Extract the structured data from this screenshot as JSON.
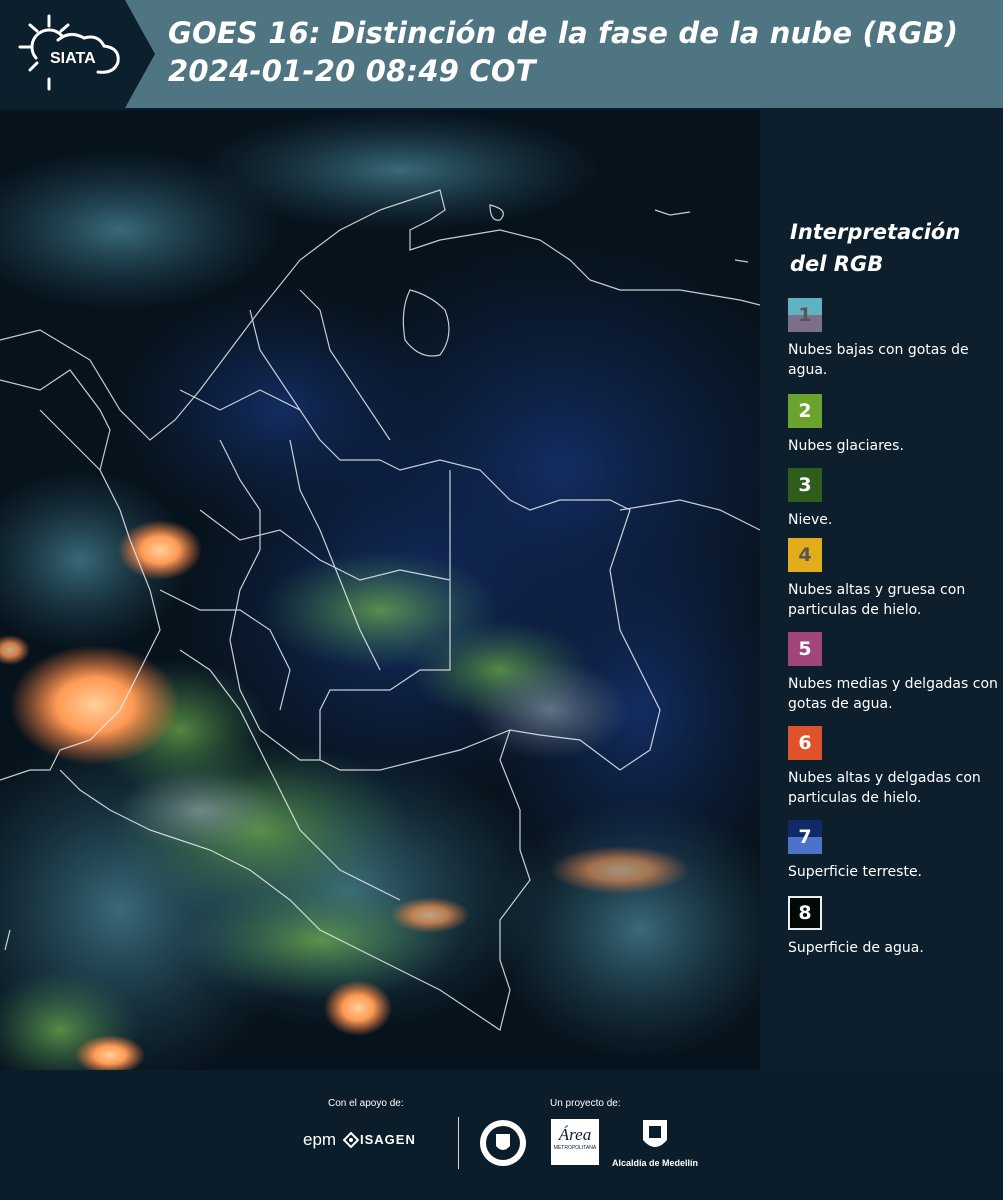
{
  "header": {
    "logo_text": "SIATA",
    "title_line1": "GOES 16: Distinción de la fase de la nube (RGB)",
    "title_line2": " 2024-01-20 08:49 COT"
  },
  "legend": {
    "title_line1": "Interpretación",
    "title_line2": "del RGB",
    "items": [
      {
        "num": "1",
        "label": "Nubes bajas con gotas de agua.",
        "color_top": "#5fb3c0",
        "color_bottom": "#7b6f8c",
        "text_color": "#555"
      },
      {
        "num": "2",
        "label": "Nubes glaciares.",
        "color_top": "#6aa32e",
        "color_bottom": "#6aa32e",
        "text_color": "#fff"
      },
      {
        "num": "3",
        "label": "Nieve.",
        "color_top": "#2f5d1c",
        "color_bottom": "#2f5d1c",
        "text_color": "#fff"
      },
      {
        "num": "4",
        "label": "Nubes altas y gruesa con particulas de hielo.",
        "color_top": "#e2ad1a",
        "color_bottom": "#e2ad1a",
        "text_color": "#555"
      },
      {
        "num": "5",
        "label": "Nubes medias y delgadas con gotas de agua.",
        "color_top": "#a0467a",
        "color_bottom": "#a0467a",
        "text_color": "#fff"
      },
      {
        "num": "6",
        "label": "Nubes altas y delgadas con particulas de hielo.",
        "color_top": "#e0522a",
        "color_bottom": "#e0522a",
        "text_color": "#fff"
      },
      {
        "num": "7",
        "label": "Superficie terreste.",
        "color_top": "#0f2a66",
        "color_bottom": "#4a73c9",
        "text_color": "#fff"
      },
      {
        "num": "8",
        "label": "Superficie de agua.",
        "color_top": "#030a06",
        "color_bottom": "#030a06",
        "text_color": "#fff"
      }
    ]
  },
  "footer": {
    "support_label": "Con el apoyo de:",
    "project_label": "Un proyecto de:",
    "epm": "epm",
    "isagen": "ISAGEN",
    "area_text": "Área",
    "area_sub": "METROPOLITANA",
    "alcaldia": "Alcaldía de Medellín"
  },
  "colors": {
    "header_bg": "#4f7583",
    "panel_bg": "#0d1f2c"
  }
}
